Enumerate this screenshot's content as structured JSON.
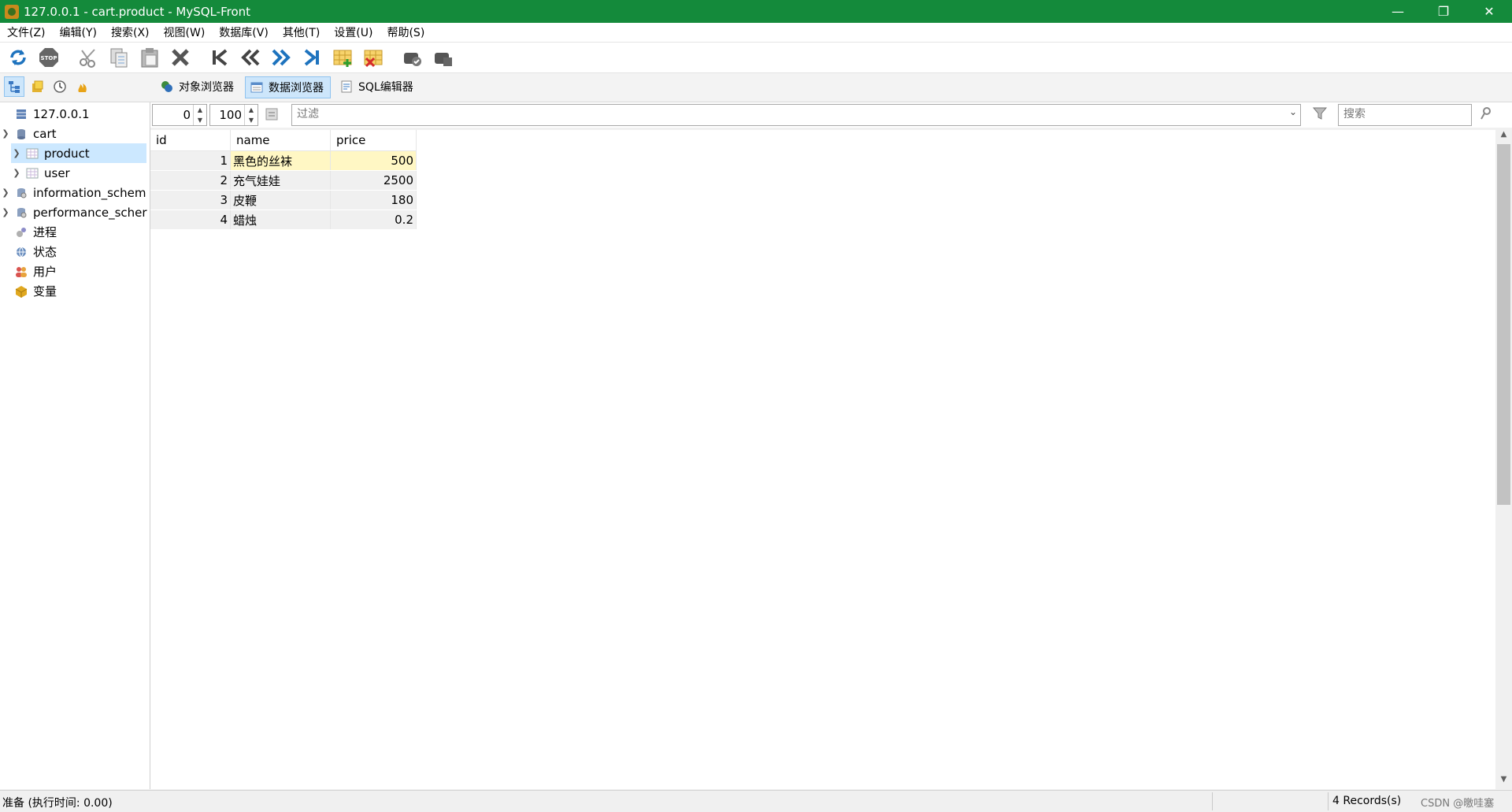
{
  "window": {
    "title": "127.0.0.1 - cart.product - MySQL-Front",
    "controls": [
      "—",
      "❐",
      "✕"
    ]
  },
  "menu": [
    "文件(Z)",
    "编辑(Y)",
    "搜索(X)",
    "视图(W)",
    "数据库(V)",
    "其他(T)",
    "设置(U)",
    "帮助(S)"
  ],
  "toolbar": {
    "icons": [
      "refresh-icon",
      "stop-icon",
      "cut-icon",
      "copy-icon",
      "paste-icon",
      "delete-icon",
      "first-record-icon",
      "prev-page-icon",
      "next-page-icon",
      "last-record-icon",
      "insert-record-icon",
      "delete-record-icon",
      "post-icon",
      "cancel-icon"
    ],
    "stop_label": "STOP"
  },
  "view_tabs": [
    {
      "label": "对象浏览器",
      "icon": "object-browser-icon",
      "active": false
    },
    {
      "label": "数据浏览器",
      "icon": "data-browser-icon",
      "active": true
    },
    {
      "label": "SQL编辑器",
      "icon": "sql-editor-icon",
      "active": false
    }
  ],
  "tree": {
    "server": "127.0.0.1",
    "database": "cart",
    "tables": [
      "product",
      "user"
    ],
    "other_dbs": [
      "information_schem",
      "performance_scher"
    ],
    "misc": [
      "进程",
      "状态",
      "用户",
      "变量"
    ]
  },
  "filter": {
    "offset": "0",
    "limit": "100",
    "placeholder": "过滤",
    "search_placeholder": "搜索"
  },
  "table": {
    "columns": [
      "id",
      "name",
      "price"
    ],
    "rows": [
      [
        "1",
        "黑色的丝袜",
        "500"
      ],
      [
        "2",
        "充气娃娃",
        "2500"
      ],
      [
        "3",
        "皮鞭",
        "180"
      ],
      [
        "4",
        "蜡烛",
        "0.2"
      ]
    ]
  },
  "status": {
    "left": "准备  (执行时间: 0.00)",
    "records": "4 Records(s)",
    "watermark": "CSDN @曒哇塞"
  }
}
